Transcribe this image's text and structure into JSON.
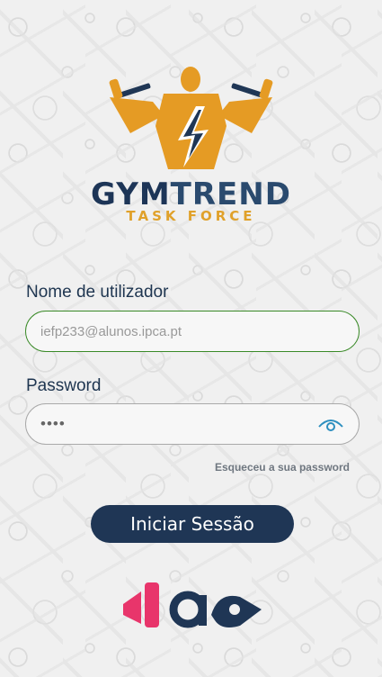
{
  "brand": {
    "name_part1": "GYM",
    "name_part2": "TREND",
    "subtitle": "TASK FORCE",
    "logo_icon": "bodybuilder-lightning-logo"
  },
  "form": {
    "username_label": "Nome de utilizador",
    "username_value": "iefp233@alunos.ipca.pt",
    "password_label": "Password",
    "password_value": "••••",
    "password_icon": "eye-icon",
    "forgot_label": "Esqueceu a sua password",
    "submit_label": "Iniciar Sessão"
  },
  "footer": {
    "logo_icon": "iap-logo"
  },
  "colors": {
    "primary": "#1f3655",
    "accent_orange": "#e59b24",
    "active_border": "#3a8a28",
    "iap_pink": "#e8356b"
  }
}
